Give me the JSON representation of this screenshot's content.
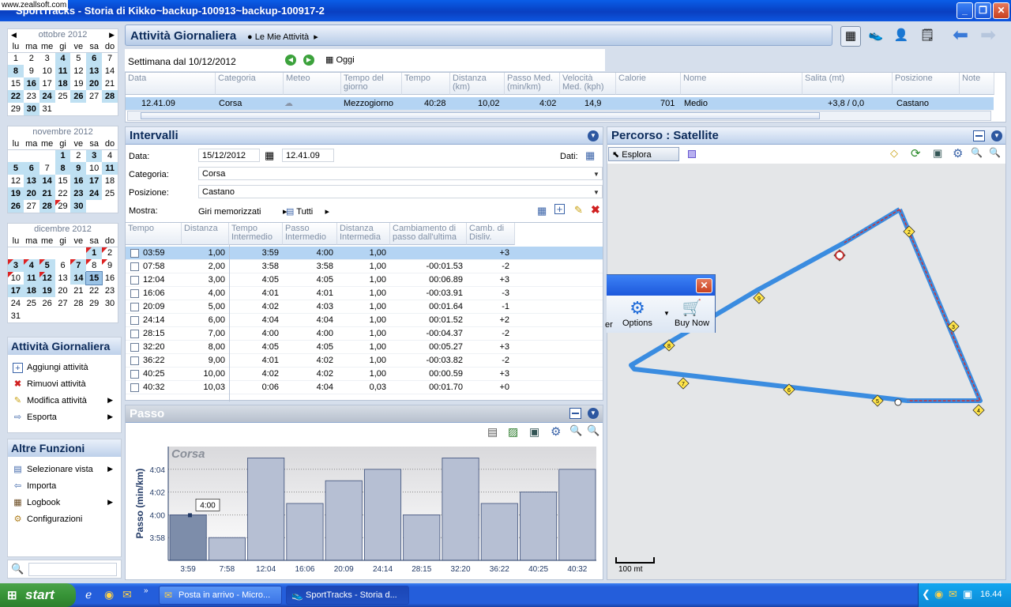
{
  "window": {
    "title": "SportTracks - Storia di Kikko~backup-100913~backup-100917-2",
    "watermark": "www.zeallsoft.com"
  },
  "calendar": {
    "dow": [
      "lu",
      "ma",
      "me",
      "gi",
      "ve",
      "sa",
      "do"
    ],
    "months": [
      {
        "name": "ottobre 2012",
        "weeks": [
          [
            {
              "d": "1"
            },
            {
              "d": "2"
            },
            {
              "d": "3"
            },
            {
              "d": "4",
              "a": 1
            },
            {
              "d": "5"
            },
            {
              "d": "6",
              "a": 1
            },
            {
              "d": "7"
            }
          ],
          [
            {
              "d": "8",
              "a": 1
            },
            {
              "d": "9"
            },
            {
              "d": "10"
            },
            {
              "d": "11",
              "a": 1
            },
            {
              "d": "12"
            },
            {
              "d": "13",
              "a": 1
            },
            {
              "d": "14"
            }
          ],
          [
            {
              "d": "15"
            },
            {
              "d": "16",
              "a": 1
            },
            {
              "d": "17"
            },
            {
              "d": "18",
              "a": 1
            },
            {
              "d": "19"
            },
            {
              "d": "20",
              "a": 1
            },
            {
              "d": "21"
            }
          ],
          [
            {
              "d": "22",
              "a": 1
            },
            {
              "d": "23"
            },
            {
              "d": "24",
              "a": 1
            },
            {
              "d": "25"
            },
            {
              "d": "26",
              "a": 1
            },
            {
              "d": "27"
            },
            {
              "d": "28",
              "a": 1
            }
          ],
          [
            {
              "d": "29"
            },
            {
              "d": "30",
              "a": 1
            },
            {
              "d": "31"
            },
            {
              "d": ""
            },
            {
              "d": ""
            },
            {
              "d": ""
            },
            {
              "d": ""
            }
          ]
        ]
      },
      {
        "name": "novembre 2012",
        "weeks": [
          [
            {
              "d": ""
            },
            {
              "d": ""
            },
            {
              "d": ""
            },
            {
              "d": "1",
              "a": 1
            },
            {
              "d": "2"
            },
            {
              "d": "3",
              "a": 1
            },
            {
              "d": "4"
            }
          ],
          [
            {
              "d": "5",
              "a": 1
            },
            {
              "d": "6",
              "a": 1
            },
            {
              "d": "7"
            },
            {
              "d": "8",
              "a": 1
            },
            {
              "d": "9",
              "a": 1
            },
            {
              "d": "10"
            },
            {
              "d": "11",
              "a": 1
            }
          ],
          [
            {
              "d": "12"
            },
            {
              "d": "13",
              "a": 1
            },
            {
              "d": "14",
              "a": 1
            },
            {
              "d": "15"
            },
            {
              "d": "16",
              "a": 1
            },
            {
              "d": "17",
              "a": 1
            },
            {
              "d": "18"
            }
          ],
          [
            {
              "d": "19",
              "a": 1
            },
            {
              "d": "20",
              "a": 1
            },
            {
              "d": "21",
              "a": 1
            },
            {
              "d": "22"
            },
            {
              "d": "23",
              "a": 1
            },
            {
              "d": "24",
              "a": 1
            },
            {
              "d": "25"
            }
          ],
          [
            {
              "d": "26",
              "a": 1
            },
            {
              "d": "27"
            },
            {
              "d": "28",
              "a": 1
            },
            {
              "d": "29",
              "f": 1
            },
            {
              "d": "30",
              "a": 1
            },
            {
              "d": ""
            },
            {
              "d": ""
            }
          ]
        ]
      },
      {
        "name": "dicembre 2012",
        "weeks": [
          [
            {
              "d": ""
            },
            {
              "d": ""
            },
            {
              "d": ""
            },
            {
              "d": ""
            },
            {
              "d": ""
            },
            {
              "d": "1",
              "a": 1,
              "f": 1
            },
            {
              "d": "2",
              "f": 1
            }
          ],
          [
            {
              "d": "3",
              "a": 1,
              "f": 1
            },
            {
              "d": "4",
              "a": 1,
              "f": 1
            },
            {
              "d": "5",
              "a": 1,
              "f": 1
            },
            {
              "d": "6"
            },
            {
              "d": "7",
              "a": 1,
              "f": 1
            },
            {
              "d": "8",
              "f": 1
            },
            {
              "d": "9",
              "f": 1
            }
          ],
          [
            {
              "d": "10",
              "f": 1
            },
            {
              "d": "11",
              "a": 1
            },
            {
              "d": "12",
              "a": 1,
              "f": 1
            },
            {
              "d": "13"
            },
            {
              "d": "14",
              "a": 1
            },
            {
              "d": "15",
              "a": 1,
              "s": 1
            },
            {
              "d": "16"
            }
          ],
          [
            {
              "d": "17",
              "a": 1
            },
            {
              "d": "18",
              "a": 1
            },
            {
              "d": "19",
              "a": 1
            },
            {
              "d": "20"
            },
            {
              "d": "21"
            },
            {
              "d": "22"
            },
            {
              "d": "23"
            }
          ],
          [
            {
              "d": "24"
            },
            {
              "d": "25"
            },
            {
              "d": "26"
            },
            {
              "d": "27"
            },
            {
              "d": "28"
            },
            {
              "d": "29"
            },
            {
              "d": "30"
            }
          ],
          [
            {
              "d": "31"
            },
            {
              "d": ""
            },
            {
              "d": ""
            },
            {
              "d": ""
            },
            {
              "d": ""
            },
            {
              "d": ""
            },
            {
              "d": ""
            }
          ]
        ]
      }
    ]
  },
  "actions_panel": {
    "title": "Attività Giornaliera",
    "items": [
      {
        "label": "Aggiungi attività"
      },
      {
        "label": "Rimuovi attività"
      },
      {
        "label": "Modifica attività"
      },
      {
        "label": "Esporta"
      }
    ]
  },
  "other_panel": {
    "title": "Altre Funzioni",
    "items": [
      {
        "label": "Selezionare vista"
      },
      {
        "label": "Importa"
      },
      {
        "label": "Logbook"
      },
      {
        "label": "Configurazioni"
      }
    ]
  },
  "header": {
    "title": "Attività Giornaliera",
    "crumb": "Le Mie Attività"
  },
  "week": {
    "label": "Settimana dal 10/12/2012",
    "today": "Oggi"
  },
  "activity_grid": {
    "columns": [
      "Data",
      "Categoria",
      "Meteo",
      "Tempo del giorno",
      "Tempo",
      "Distanza (km)",
      "Passo Med. (min/km)",
      "Velocità Med. (kph)",
      "Calorie",
      "Nome",
      "Salita (mt)",
      "Posizione",
      "Note"
    ],
    "row": {
      "time": "12.41.09",
      "cat": "Corsa",
      "tod": "Mezzogiorno",
      "tempo": "40:28",
      "dist": "10,02",
      "pace": "4:02",
      "speed": "14,9",
      "cal": "701",
      "name": "Medio",
      "climb": "+3,8 / 0,0",
      "pos": "Castano"
    }
  },
  "intervals": {
    "title": "Intervalli",
    "date_label": "Data:",
    "date": "15/12/2012",
    "time": "12.41.09",
    "dati_label": "Dati:",
    "cat_label": "Categoria:",
    "cat": "Corsa",
    "pos_label": "Posizione:",
    "pos": "Castano",
    "show_label": "Mostra:",
    "show": "Giri memorizzati",
    "all": "Tutti",
    "columns": [
      "Tempo",
      "Distanza",
      "Tempo Intermedio",
      "Passo Intermedio",
      "Distanza Intermedia",
      "Cambiamento di passo dall'ultima",
      "Camb. di Disliv."
    ],
    "rows": [
      [
        "03:59",
        "1,00",
        "3:59",
        "4:00",
        "1,00",
        "",
        "+3"
      ],
      [
        "07:58",
        "2,00",
        "3:58",
        "3:58",
        "1,00",
        "-00:01.53",
        "-2"
      ],
      [
        "12:04",
        "3,00",
        "4:05",
        "4:05",
        "1,00",
        "00:06.89",
        "+3"
      ],
      [
        "16:06",
        "4,00",
        "4:01",
        "4:01",
        "1,00",
        "-00:03.91",
        "-3"
      ],
      [
        "20:09",
        "5,00",
        "4:02",
        "4:03",
        "1,00",
        "00:01.64",
        "-1"
      ],
      [
        "24:14",
        "6,00",
        "4:04",
        "4:04",
        "1,00",
        "00:01.52",
        "+2"
      ],
      [
        "28:15",
        "7,00",
        "4:00",
        "4:00",
        "1,00",
        "-00:04.37",
        "-2"
      ],
      [
        "32:20",
        "8,00",
        "4:05",
        "4:05",
        "1,00",
        "00:05.27",
        "+3"
      ],
      [
        "36:22",
        "9,00",
        "4:01",
        "4:02",
        "1,00",
        "-00:03.82",
        "-2"
      ],
      [
        "40:25",
        "10,00",
        "4:02",
        "4:02",
        "1,00",
        "00:00.59",
        "+3"
      ],
      [
        "40:32",
        "10,03",
        "0:06",
        "4:04",
        "0,03",
        "00:01.70",
        "+0"
      ]
    ]
  },
  "pace_panel": {
    "title": "Passo"
  },
  "chart_data": {
    "type": "bar",
    "title": "Corsa",
    "ylabel": "Passo (min/km)",
    "categories": [
      "3:59",
      "7:58",
      "12:04",
      "16:06",
      "20:09",
      "24:14",
      "28:15",
      "32:20",
      "36:22",
      "40:25",
      "40:32"
    ],
    "values_sec": [
      240,
      238,
      245,
      241,
      243,
      244,
      240,
      245,
      241,
      242,
      244
    ],
    "yticks": [
      "3:58",
      "4:00",
      "4:02",
      "4:04"
    ],
    "ytick_sec": [
      238,
      240,
      242,
      244
    ],
    "ylim_sec": [
      236,
      246
    ],
    "tooltip": "4:00",
    "bar_color": "#b6bfd3",
    "selected_color": "#7d8daa"
  },
  "map": {
    "title": "Percorso  : Satellite",
    "explore": "Esplora",
    "scale": "100 mt",
    "markers": [
      "2",
      "3",
      "4",
      "5",
      "6",
      "7",
      "8",
      "9"
    ],
    "route_color": "#3a8ce0",
    "gps_color": "#d03030"
  },
  "popup": {
    "options": "Options",
    "buy": "Buy Now",
    "cut": "er"
  },
  "taskbar": {
    "start": "start",
    "task1": "Posta in arrivo - Micro...",
    "task2": "SportTracks - Storia d...",
    "clock": "16.44"
  }
}
